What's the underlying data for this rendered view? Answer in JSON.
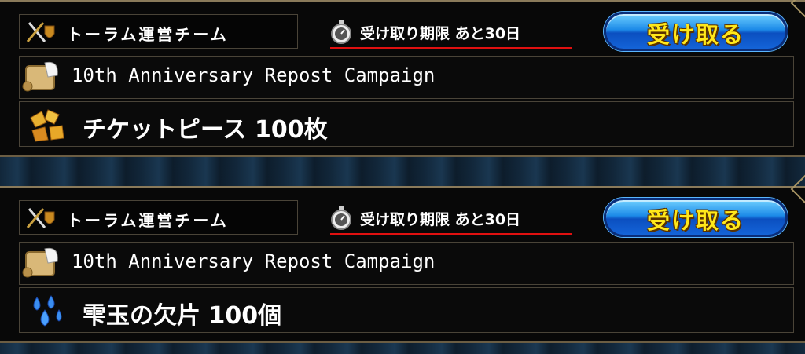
{
  "colors": {
    "accent_button": "#1c8ae8",
    "button_text": "#ffe81a",
    "deadline_underline": "#e01010"
  },
  "messages": [
    {
      "sender": "トーラム運営チーム",
      "sender_icon": "crossed-swords-shield-icon",
      "deadline_icon": "stopwatch-icon",
      "deadline": "受け取り期限 あと30日",
      "receive_label": "受け取る",
      "title_icon": "scroll-quill-icon",
      "title": "10th Anniversary Repost Campaign",
      "item_icon": "ticket-pieces-icon",
      "item": "チケットピース 100枚"
    },
    {
      "sender": "トーラム運営チーム",
      "sender_icon": "crossed-swords-shield-icon",
      "deadline_icon": "stopwatch-icon",
      "deadline": "受け取り期限 あと30日",
      "receive_label": "受け取る",
      "title_icon": "scroll-quill-icon",
      "title": "10th Anniversary Repost Campaign",
      "item_icon": "water-drops-icon",
      "item": "雫玉の欠片 100個"
    }
  ]
}
